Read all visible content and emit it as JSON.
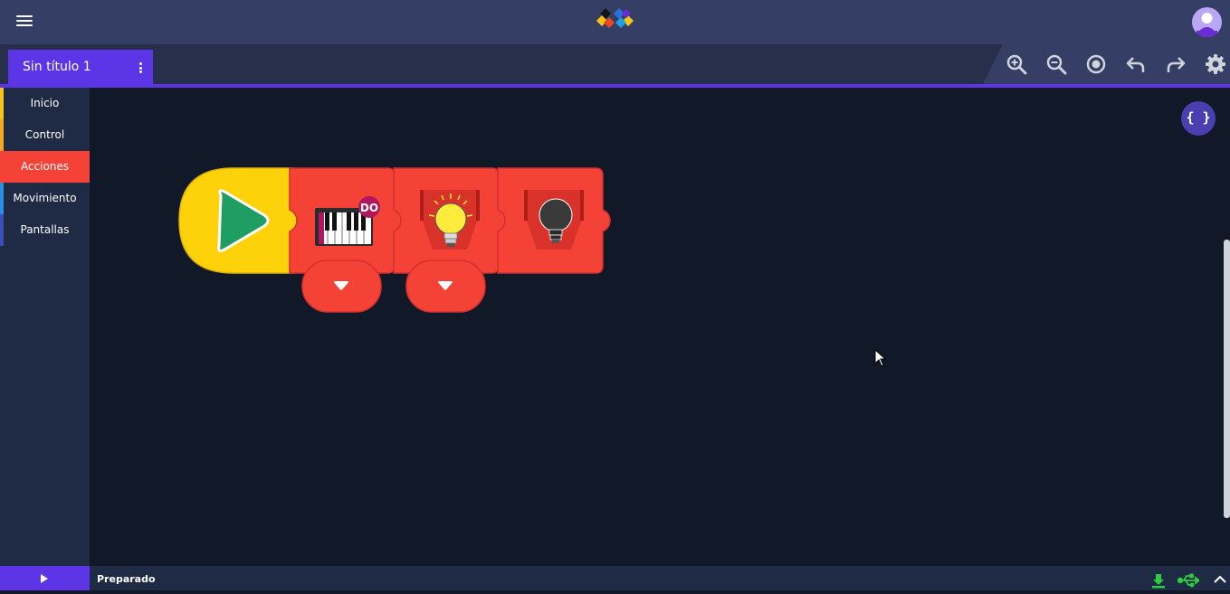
{
  "header": {
    "menu_icon": "hamburger-icon",
    "logo_icon": "app-logo",
    "avatar_icon": "user-avatar-icon"
  },
  "tab": {
    "title": "Sin título 1",
    "menu_icon": "more-vertical-icon"
  },
  "toolbar": [
    {
      "icon": "zoom-in-icon"
    },
    {
      "icon": "zoom-out-icon"
    },
    {
      "icon": "center-target-icon"
    },
    {
      "icon": "undo-icon"
    },
    {
      "icon": "redo-icon"
    },
    {
      "icon": "settings-gear-icon"
    }
  ],
  "sidebar": {
    "items": [
      {
        "label": "Inicio",
        "color": "#f5c518"
      },
      {
        "label": "Control",
        "color": "#f5a623"
      },
      {
        "label": "Acciones",
        "color": "#f44336",
        "active": true
      },
      {
        "label": "Movimiento",
        "color": "#2e8ee6"
      },
      {
        "label": "Pantallas",
        "color": "#3b4db8"
      }
    ]
  },
  "canvas": {
    "code_button": "{ }",
    "blocks": [
      {
        "type": "start",
        "icon": "play-icon",
        "color": "#fdd20a"
      },
      {
        "type": "action",
        "icon": "piano-icon",
        "badge": "DO",
        "has_dropdown": true,
        "color": "#f44336"
      },
      {
        "type": "action",
        "icon": "light-on-icon",
        "has_dropdown": true,
        "color": "#f44336"
      },
      {
        "type": "action",
        "icon": "light-off-icon",
        "color": "#f44336"
      }
    ]
  },
  "footer": {
    "status": "Preparado",
    "icons": [
      "download-icon",
      "usb-icon",
      "chevron-up-icon"
    ]
  },
  "colors": {
    "accent": "#5b35e6",
    "topbar": "#353e64",
    "canvas": "#111827",
    "action_block": "#f44336",
    "start_block": "#fdd20a"
  }
}
